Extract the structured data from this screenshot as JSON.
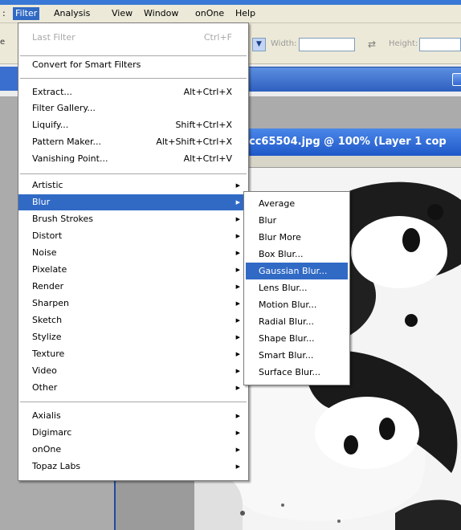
{
  "menubar": {
    "items": [
      {
        "label": "Filter",
        "active": true
      },
      {
        "label": "Analysis"
      },
      {
        "label": "View"
      },
      {
        "label": "Window"
      },
      {
        "label": "onOne"
      },
      {
        "label": "Help"
      }
    ]
  },
  "options_bar": {
    "width_label": "Width:",
    "height_label": "Height:"
  },
  "document": {
    "title": "cc65504.jpg @ 100% (Layer 1 cop"
  },
  "filter_menu": {
    "last_filter": {
      "label": "Last Filter",
      "shortcut": "Ctrl+F"
    },
    "convert_smart": "Convert for Smart Filters",
    "group_tools": [
      {
        "label": "Extract...",
        "shortcut": "Alt+Ctrl+X"
      },
      {
        "label": "Filter Gallery..."
      },
      {
        "label": "Liquify...",
        "shortcut": "Shift+Ctrl+X"
      },
      {
        "label": "Pattern Maker...",
        "shortcut": "Alt+Shift+Ctrl+X"
      },
      {
        "label": "Vanishing Point...",
        "shortcut": "Alt+Ctrl+V"
      }
    ],
    "group_filters": [
      {
        "label": "Artistic"
      },
      {
        "label": "Blur",
        "highlighted": true
      },
      {
        "label": "Brush Strokes"
      },
      {
        "label": "Distort"
      },
      {
        "label": "Noise"
      },
      {
        "label": "Pixelate"
      },
      {
        "label": "Render"
      },
      {
        "label": "Sharpen"
      },
      {
        "label": "Sketch"
      },
      {
        "label": "Stylize"
      },
      {
        "label": "Texture"
      },
      {
        "label": "Video"
      },
      {
        "label": "Other"
      }
    ],
    "group_plugins": [
      {
        "label": "Axialis"
      },
      {
        "label": "Digimarc"
      },
      {
        "label": "onOne"
      },
      {
        "label": "Topaz Labs"
      }
    ]
  },
  "blur_submenu": {
    "items": [
      {
        "label": "Average"
      },
      {
        "label": "Blur"
      },
      {
        "label": "Blur More"
      },
      {
        "label": "Box Blur..."
      },
      {
        "label": "Gaussian Blur...",
        "highlighted": true
      },
      {
        "label": "Lens Blur..."
      },
      {
        "label": "Motion Blur..."
      },
      {
        "label": "Radial Blur..."
      },
      {
        "label": "Shape Blur..."
      },
      {
        "label": "Smart Blur..."
      },
      {
        "label": "Surface Blur..."
      }
    ]
  },
  "colors": {
    "highlight": "#316ac5",
    "title_bar": "#2e5fbf",
    "menu_bg": "#ffffff",
    "menubar_bg": "#ece9d8"
  }
}
